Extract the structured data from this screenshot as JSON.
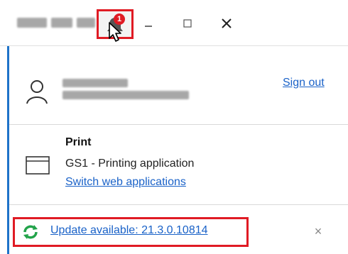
{
  "titlebar": {
    "notifications": {
      "badge_count": "1",
      "icon": "bell-icon",
      "highlight_color": "#e01b24"
    },
    "window_controls": {
      "minimize_icon": "minimize-icon",
      "maximize_icon": "maximize-icon",
      "close_icon": "close-icon"
    }
  },
  "profile": {
    "avatar_icon": "person-icon",
    "sign_out_label": "Sign out"
  },
  "application": {
    "icon": "window-icon",
    "title": "Print",
    "description": "GS1 - Printing application",
    "switch_label": "Switch web applications"
  },
  "update": {
    "icon": "refresh-icon",
    "label": "Update available: 21.3.0.10814",
    "close_glyph": "×",
    "link_color": "#1a62c8",
    "icon_color": "#22a34a"
  },
  "theme": {
    "accent_border": "#1e73c9",
    "highlight": "#e01b24"
  }
}
